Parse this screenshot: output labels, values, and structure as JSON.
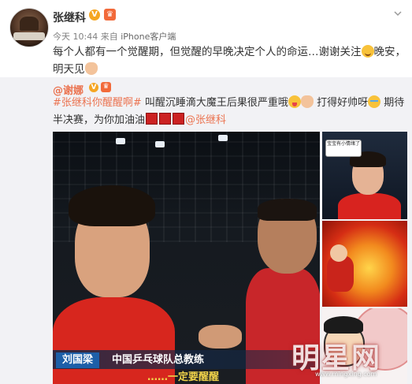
{
  "post": {
    "author": "张继科",
    "verified_badge": "V",
    "time": "今天 10:44",
    "source_prefix": "来自",
    "source": "iPhone客户端",
    "text_1": "每个人都有一个觉醒期，但觉醒的早晚决定个人的命运…谢谢关注",
    "text_2": "晚安，明天见"
  },
  "retweet": {
    "author_prefix": "@",
    "author": "谢娜",
    "verified_badge": "V",
    "hashtag": "#张继科你醒醒啊#",
    "text_1": " 叫醒沉睡滴大魔王后果很严重哦",
    "text_2": " 打得好帅呀",
    "text_3": " 期待半决赛，为你加油油",
    "mention": "@张继科"
  },
  "image": {
    "caption_name": "刘国梁",
    "caption_title": "中国乒乓球队总教练",
    "caption_sub": "……一定要醒醒"
  },
  "thumb1": {
    "bubble_text": "宝宝有小情绪了"
  },
  "watermark": {
    "text": "明星网",
    "url": "www.mingxing.com"
  },
  "colors": {
    "link": "#eb7350",
    "retweet_bg": "#f2f2f5",
    "verified": "#f5a623"
  },
  "icons": [
    "chevron-down-icon",
    "crown-icon",
    "smile-emoji",
    "pray-emoji",
    "tongue-emoji",
    "victory-emoji",
    "cry-emoji",
    "flag-emoji"
  ]
}
